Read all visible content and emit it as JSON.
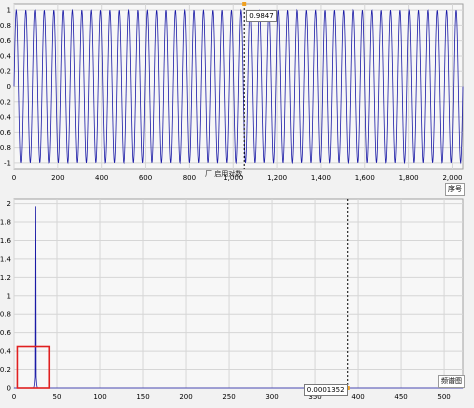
{
  "top_chart": {
    "x_button_label": "序号",
    "cursor_readout": "0.9847"
  },
  "middle": {
    "caption": "厂 启用对数",
    "right_button_label": "频谱图"
  },
  "bottom_chart": {
    "cursor_readout": "0.0001352"
  },
  "colors": {
    "signal": "#1a1aa6",
    "cursor": "#000000",
    "cursor_marker": "#f0a020",
    "highlight_box": "#e02020",
    "grid": "#d6d6d6",
    "background": "#f7f7f7"
  },
  "chart_data": [
    {
      "type": "line",
      "x_ticks": [
        "0",
        "200",
        "400",
        "600",
        "800",
        "1,000",
        "1,200",
        "1,400",
        "1,600",
        "1,800",
        "2,000"
      ],
      "y_ticks": [
        "1",
        "0.8",
        "0.6",
        "0.4",
        "0.2",
        "0",
        "-0.2",
        "-0.4",
        "-0.6",
        "-0.8",
        "-1"
      ],
      "xlim": [
        0,
        2048
      ],
      "ylim": [
        -1.08,
        1.08
      ],
      "series": [
        {
          "function": "sin",
          "amplitude": 1,
          "cycles": 48,
          "x_start": 0,
          "x_end": 2048
        }
      ],
      "cursor_x": 1050,
      "grid": true
    },
    {
      "type": "line",
      "x_ticks": [
        "0",
        "50",
        "100",
        "150",
        "200",
        "250",
        "300",
        "350",
        "400",
        "450",
        "500"
      ],
      "y_ticks": [
        "2",
        "1.8",
        "1.6",
        "1.4",
        "1.2",
        "1",
        "0.8",
        "0.6",
        "0.4",
        "0.2",
        "0"
      ],
      "xlim": [
        0,
        522
      ],
      "ylim": [
        0,
        2.05
      ],
      "series": [
        {
          "x": [
            0,
            23,
            23.5,
            24,
            24.5,
            25,
            25.5,
            26,
            26.5,
            27,
            30,
            522
          ],
          "y": [
            0,
            0,
            0.02,
            0.05,
            0.12,
            1.97,
            0.12,
            0.05,
            0.02,
            0,
            0,
            0
          ]
        }
      ],
      "cursor_x": 388,
      "highlight_region": {
        "x": [
          4,
          41
        ],
        "y": [
          0,
          0.45
        ]
      },
      "grid": true
    }
  ]
}
